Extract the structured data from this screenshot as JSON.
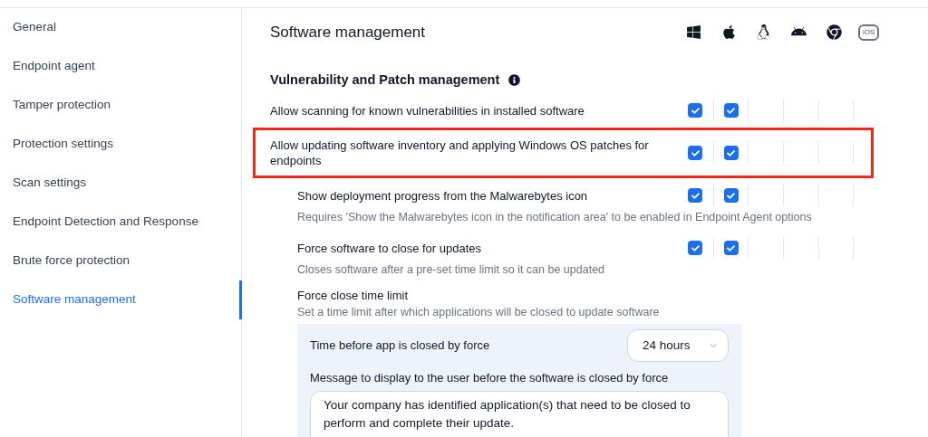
{
  "sidebar": {
    "items": [
      {
        "label": "General",
        "selected": false
      },
      {
        "label": "Endpoint agent",
        "selected": false
      },
      {
        "label": "Tamper protection",
        "selected": false
      },
      {
        "label": "Protection settings",
        "selected": false
      },
      {
        "label": "Scan settings",
        "selected": false
      },
      {
        "label": "Endpoint Detection and Response",
        "selected": false
      },
      {
        "label": "Brute force protection",
        "selected": false
      },
      {
        "label": "Software management",
        "selected": true
      }
    ]
  },
  "header": {
    "title": "Software management",
    "platforms": [
      {
        "kind": "windows"
      },
      {
        "kind": "apple"
      },
      {
        "kind": "linux"
      },
      {
        "kind": "android"
      },
      {
        "kind": "chrome"
      },
      {
        "kind": "badge",
        "label": "iOS"
      }
    ]
  },
  "section": {
    "title": "Vulnerability and Patch management",
    "settings": [
      {
        "label": "Allow scanning for known vulnerabilities in installed software",
        "indented": false,
        "highlighted": false,
        "checks": [
          {
            "checked": true
          },
          {
            "checked": true
          }
        ]
      },
      {
        "label": "Allow updating software inventory and applying Windows OS patches for endpoints",
        "indented": false,
        "highlighted": true,
        "checks": [
          {
            "checked": true
          },
          {
            "checked": true
          }
        ]
      },
      {
        "label": "Show deployment progress from the Malwarebytes icon",
        "description": "Requires 'Show the Malwarebytes icon in the notification area' to be enabled in Endpoint Agent options",
        "indented": true,
        "highlighted": false,
        "checks": [
          {
            "checked": true
          },
          {
            "checked": true
          }
        ]
      },
      {
        "label": "Force software to close for updates",
        "description": "Closes software after a pre-set time limit so it can be updated",
        "indented": true,
        "highlighted": false,
        "checks": [
          {
            "checked": true
          },
          {
            "checked": true
          }
        ]
      }
    ]
  },
  "time_limit": {
    "title": "Force close time limit",
    "description": "Set a time limit after which applications will be closed to update software",
    "time_label": "Time before app is closed by force",
    "time_value": "24 hours",
    "message_label": "Message to display to the user before the software is closed by force",
    "message_value": "Your company has identified application(s) that need to be closed to perform and complete their update."
  }
}
